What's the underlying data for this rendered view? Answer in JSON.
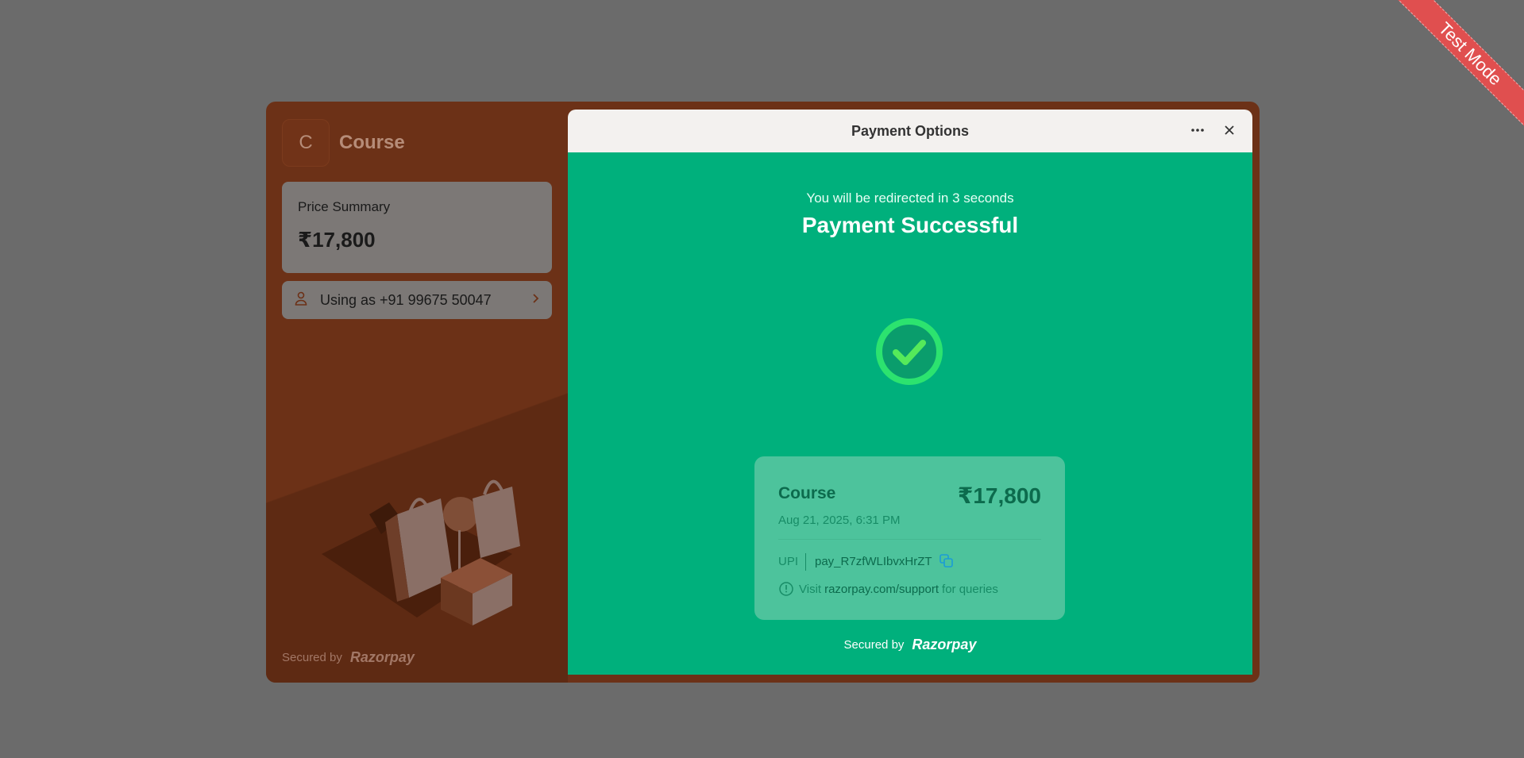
{
  "ribbon": {
    "label": "Test Mode"
  },
  "merchant": {
    "initial": "C",
    "name": "Course"
  },
  "price_summary": {
    "label": "Price Summary",
    "amount": "₹17,800"
  },
  "user": {
    "label": "Using as +91 99675 50047"
  },
  "footer_left": {
    "secured_by": "Secured by",
    "brand": "Razorpay"
  },
  "header": {
    "title": "Payment Options"
  },
  "success": {
    "redirect_text": "You will be redirected in 3 seconds",
    "title": "Payment Successful",
    "receipt": {
      "item": "Course",
      "amount": "₹17,800",
      "date": "Aug 21, 2025, 6:31 PM",
      "method": "UPI",
      "payment_id": "pay_R7zfWLIbvxHrZT",
      "help_prefix": "Visit",
      "help_link": "razorpay.com/support",
      "help_suffix": "for queries"
    },
    "secured_by": "Secured by",
    "brand": "Razorpay"
  },
  "colors": {
    "success_green": "#00b07c",
    "overlay": "#6b6b6b",
    "test_ribbon": "#e04f4f"
  }
}
